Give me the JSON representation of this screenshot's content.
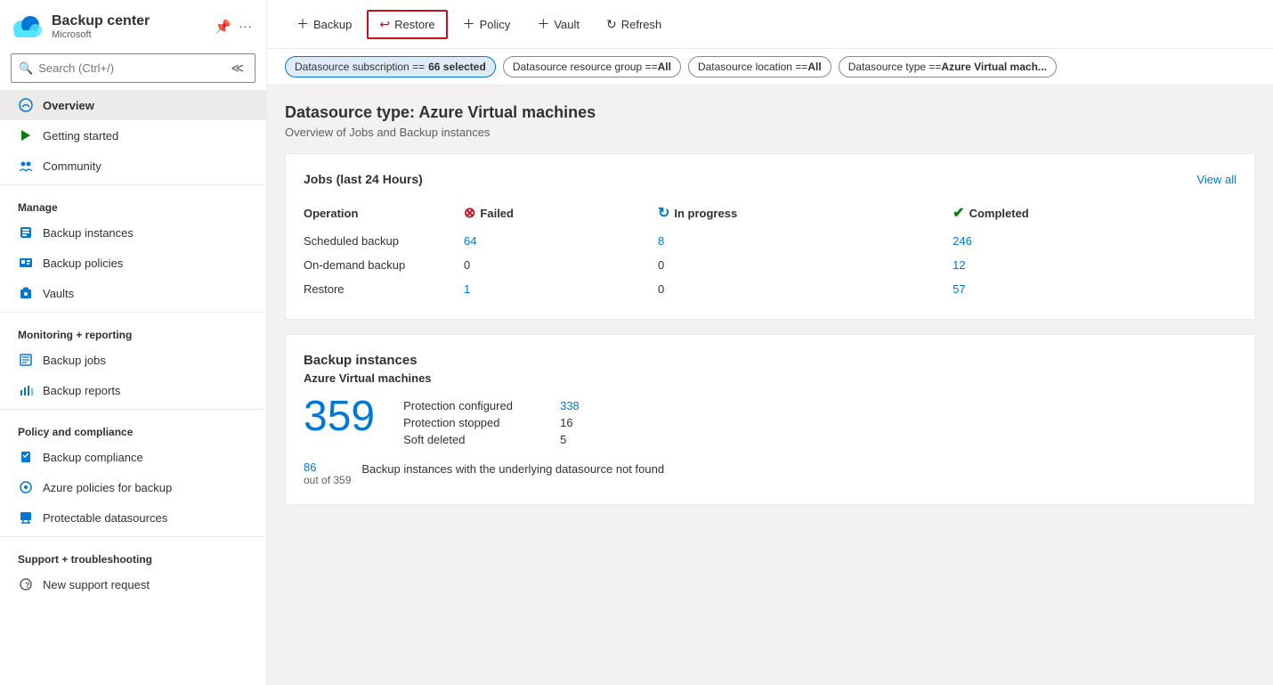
{
  "sidebar": {
    "app_title": "Backup center",
    "app_subtitle": "Microsoft",
    "search_placeholder": "Search (Ctrl+/)",
    "nav_items": [
      {
        "id": "overview",
        "label": "Overview",
        "active": true,
        "icon": "cloud-icon"
      },
      {
        "id": "getting-started",
        "label": "Getting started",
        "active": false,
        "icon": "rocket-icon"
      },
      {
        "id": "community",
        "label": "Community",
        "active": false,
        "icon": "group-icon"
      }
    ],
    "manage_label": "Manage",
    "manage_items": [
      {
        "id": "backup-instances",
        "label": "Backup instances",
        "icon": "instances-icon"
      },
      {
        "id": "backup-policies",
        "label": "Backup policies",
        "icon": "policy-icon"
      },
      {
        "id": "vaults",
        "label": "Vaults",
        "icon": "vaults-icon"
      }
    ],
    "monitoring_label": "Monitoring + reporting",
    "monitoring_items": [
      {
        "id": "backup-jobs",
        "label": "Backup jobs",
        "icon": "jobs-icon"
      },
      {
        "id": "backup-reports",
        "label": "Backup reports",
        "icon": "reports-icon"
      }
    ],
    "policy_label": "Policy and compliance",
    "policy_items": [
      {
        "id": "backup-compliance",
        "label": "Backup compliance",
        "icon": "compliance-icon"
      },
      {
        "id": "azure-policies",
        "label": "Azure policies for backup",
        "icon": "azure-policy-icon"
      },
      {
        "id": "protectable-datasources",
        "label": "Protectable datasources",
        "icon": "datasource-icon"
      }
    ],
    "support_label": "Support + troubleshooting",
    "support_items": [
      {
        "id": "new-support",
        "label": "New support request",
        "icon": "support-icon"
      }
    ]
  },
  "toolbar": {
    "backup_label": "Backup",
    "restore_label": "Restore",
    "policy_label": "Policy",
    "vault_label": "Vault",
    "refresh_label": "Refresh"
  },
  "filters": [
    {
      "label": "Datasource subscription == ",
      "value": "66 selected",
      "active": true
    },
    {
      "label": "Datasource resource group == ",
      "value": "All",
      "active": false
    },
    {
      "label": "Datasource location == ",
      "value": "All",
      "active": false
    },
    {
      "label": "Datasource type == ",
      "value": "Azure Virtual mach...",
      "active": false
    }
  ],
  "page": {
    "title": "Datasource type: Azure Virtual machines",
    "subtitle": "Overview of Jobs and Backup instances"
  },
  "jobs_card": {
    "title": "Jobs (last 24 Hours)",
    "view_all": "View all",
    "columns": {
      "operation": "Operation",
      "failed": "Failed",
      "in_progress": "In progress",
      "completed": "Completed"
    },
    "rows": [
      {
        "operation": "Scheduled backup",
        "failed": "64",
        "in_progress": "8",
        "completed": "246",
        "failed_link": true,
        "in_progress_link": true,
        "completed_link": true,
        "in_progress_zero": false,
        "failed_zero": false,
        "completed_zero": false
      },
      {
        "operation": "On-demand backup",
        "failed": "0",
        "in_progress": "0",
        "completed": "12",
        "failed_link": false,
        "in_progress_link": false,
        "completed_link": true,
        "in_progress_zero": true,
        "failed_zero": true,
        "completed_zero": false
      },
      {
        "operation": "Restore",
        "failed": "1",
        "in_progress": "0",
        "completed": "57",
        "failed_link": true,
        "in_progress_link": false,
        "completed_link": true,
        "in_progress_zero": true,
        "failed_zero": false,
        "completed_zero": false
      }
    ]
  },
  "backup_instances_card": {
    "section_title": "Backup instances",
    "subtitle": "Azure Virtual machines",
    "total_count": "359",
    "details": [
      {
        "label": "Protection configured",
        "value": "338",
        "is_link": true
      },
      {
        "label": "Protection stopped",
        "value": "16",
        "is_link": false
      },
      {
        "label": "Soft deleted",
        "value": "5",
        "is_link": false
      }
    ],
    "footer_count": "86",
    "footer_denom": "out of 359",
    "footer_desc": "Backup instances with the underlying datasource not found"
  }
}
